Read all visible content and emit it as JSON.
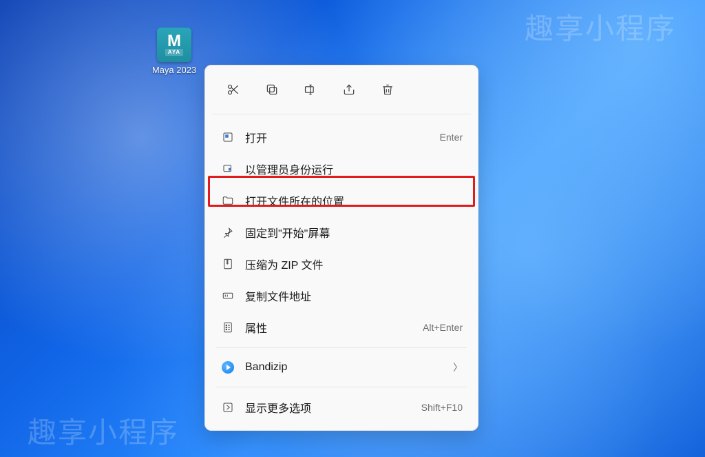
{
  "watermark": "趣享小程序",
  "desktop_icon": {
    "tile_letter": "M",
    "tile_sub": "AYA",
    "label": "Maya 2023"
  },
  "context_menu": {
    "items": [
      {
        "icon": "open-in",
        "label": "打开",
        "accel": "Enter",
        "submenu": false
      },
      {
        "icon": "shield",
        "label": "以管理员身份运行",
        "accel": "",
        "submenu": false
      },
      {
        "icon": "folder",
        "label": "打开文件所在的位置",
        "accel": "",
        "submenu": false,
        "highlighted": true
      },
      {
        "icon": "pin",
        "label": "固定到\"开始\"屏幕",
        "accel": "",
        "submenu": false
      },
      {
        "icon": "zip",
        "label": "压缩为 ZIP 文件",
        "accel": "",
        "submenu": false
      },
      {
        "icon": "path",
        "label": "复制文件地址",
        "accel": "",
        "submenu": false
      },
      {
        "icon": "properties",
        "label": "属性",
        "accel": "Alt+Enter",
        "submenu": false
      },
      {
        "icon": "bandizip",
        "label": "Bandizip",
        "accel": "",
        "submenu": true
      },
      {
        "icon": "more",
        "label": "显示更多选项",
        "accel": "Shift+F10",
        "submenu": false
      }
    ],
    "separators_after_indices": [
      6,
      7
    ]
  }
}
